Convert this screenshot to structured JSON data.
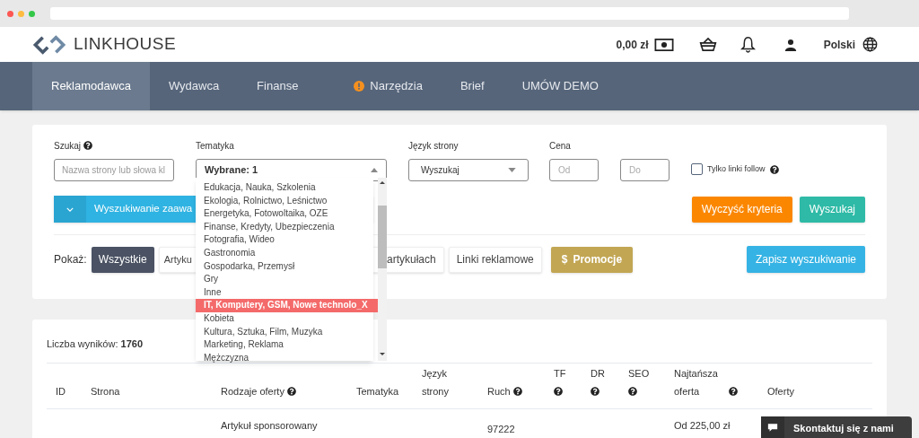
{
  "brand": {
    "name": "LINKHOUSE"
  },
  "header": {
    "balance": "0,00 zł",
    "language": "Polski"
  },
  "nav": [
    {
      "label": "Reklamodawca",
      "selected": true,
      "warning": false
    },
    {
      "label": "Wydawca",
      "selected": false,
      "warning": false
    },
    {
      "label": "Finanse",
      "selected": false,
      "warning": false
    },
    {
      "label": "Narzędzia",
      "selected": false,
      "warning": true
    },
    {
      "label": "Brief",
      "selected": false,
      "warning": false
    },
    {
      "label": "UMÓW DEMO",
      "selected": false,
      "warning": false
    }
  ],
  "filters": {
    "search": {
      "label": "Szukaj",
      "placeholder": "Nazwa strony lub słowa kl"
    },
    "topic": {
      "label": "Tematyka",
      "value": "Wybrane: 1"
    },
    "language": {
      "label": "Język strony",
      "value": "Wyszukaj"
    },
    "price": {
      "label": "Cena",
      "from_placeholder": "Od",
      "to_placeholder": "Do"
    },
    "follow": {
      "label": "Tylko linki follow",
      "checked": false
    },
    "advanced": "Wyszukiwanie zaawa",
    "clear": "Wyczyść kryteria",
    "submit": "Wyszukaj"
  },
  "show": {
    "label": "Pokaż:",
    "options": [
      {
        "label": "Wszystkie",
        "selected": true
      },
      {
        "label": "Artyku",
        "selected": false
      },
      {
        "label": "artykułach",
        "selected": false
      },
      {
        "label": "Linki reklamowe",
        "selected": false
      }
    ],
    "promo": {
      "symbol": "$",
      "label": "Promocje"
    },
    "save": "Zapisz wyszukiwanie"
  },
  "topic_dropdown": [
    {
      "label": "Edukacja, Nauka, Szkolenia",
      "selected": false
    },
    {
      "label": "Ekologia, Rolnictwo, Leśnictwo",
      "selected": false
    },
    {
      "label": "Energetyka, Fotowoltaika, OZE",
      "selected": false
    },
    {
      "label": "Finanse, Kredyty, Ubezpieczenia",
      "selected": false
    },
    {
      "label": "Fotografia, Wideo",
      "selected": false
    },
    {
      "label": "Gastronomia",
      "selected": false
    },
    {
      "label": "Gospodarka, Przemysł",
      "selected": false
    },
    {
      "label": "Gry",
      "selected": false
    },
    {
      "label": "Inne",
      "selected": false
    },
    {
      "label": "IT, Komputery, GSM, Nowe technolo_",
      "selected": true,
      "remove": "X"
    },
    {
      "label": "Kobieta",
      "selected": false
    },
    {
      "label": "Kultura, Sztuka, Film, Muzyka",
      "selected": false
    },
    {
      "label": "Marketing, Reklama",
      "selected": false
    },
    {
      "label": "Mężczyzna",
      "selected": false
    }
  ],
  "results": {
    "count_label": "Liczba wyników:",
    "count": "1760",
    "columns": [
      {
        "label": "ID",
        "help": false
      },
      {
        "label": "Strona",
        "help": false
      },
      {
        "label": "Rodzaje oferty",
        "help": true
      },
      {
        "label": "Tematyka",
        "help": false
      },
      {
        "label": "Język strony",
        "help": false
      },
      {
        "label": "Ruch",
        "help": true
      },
      {
        "label": "TF",
        "help": true
      },
      {
        "label": "DR",
        "help": true
      },
      {
        "label": "SEO",
        "help": true
      },
      {
        "label": "Najtańsza oferta",
        "help": true
      },
      {
        "label": "Oferty",
        "help": false
      }
    ],
    "row": {
      "offer": "Artykuł sponsorowany",
      "traffic": "97222",
      "price": "Od 225,00 zł"
    }
  },
  "chat": "Skontaktuj się z nami"
}
